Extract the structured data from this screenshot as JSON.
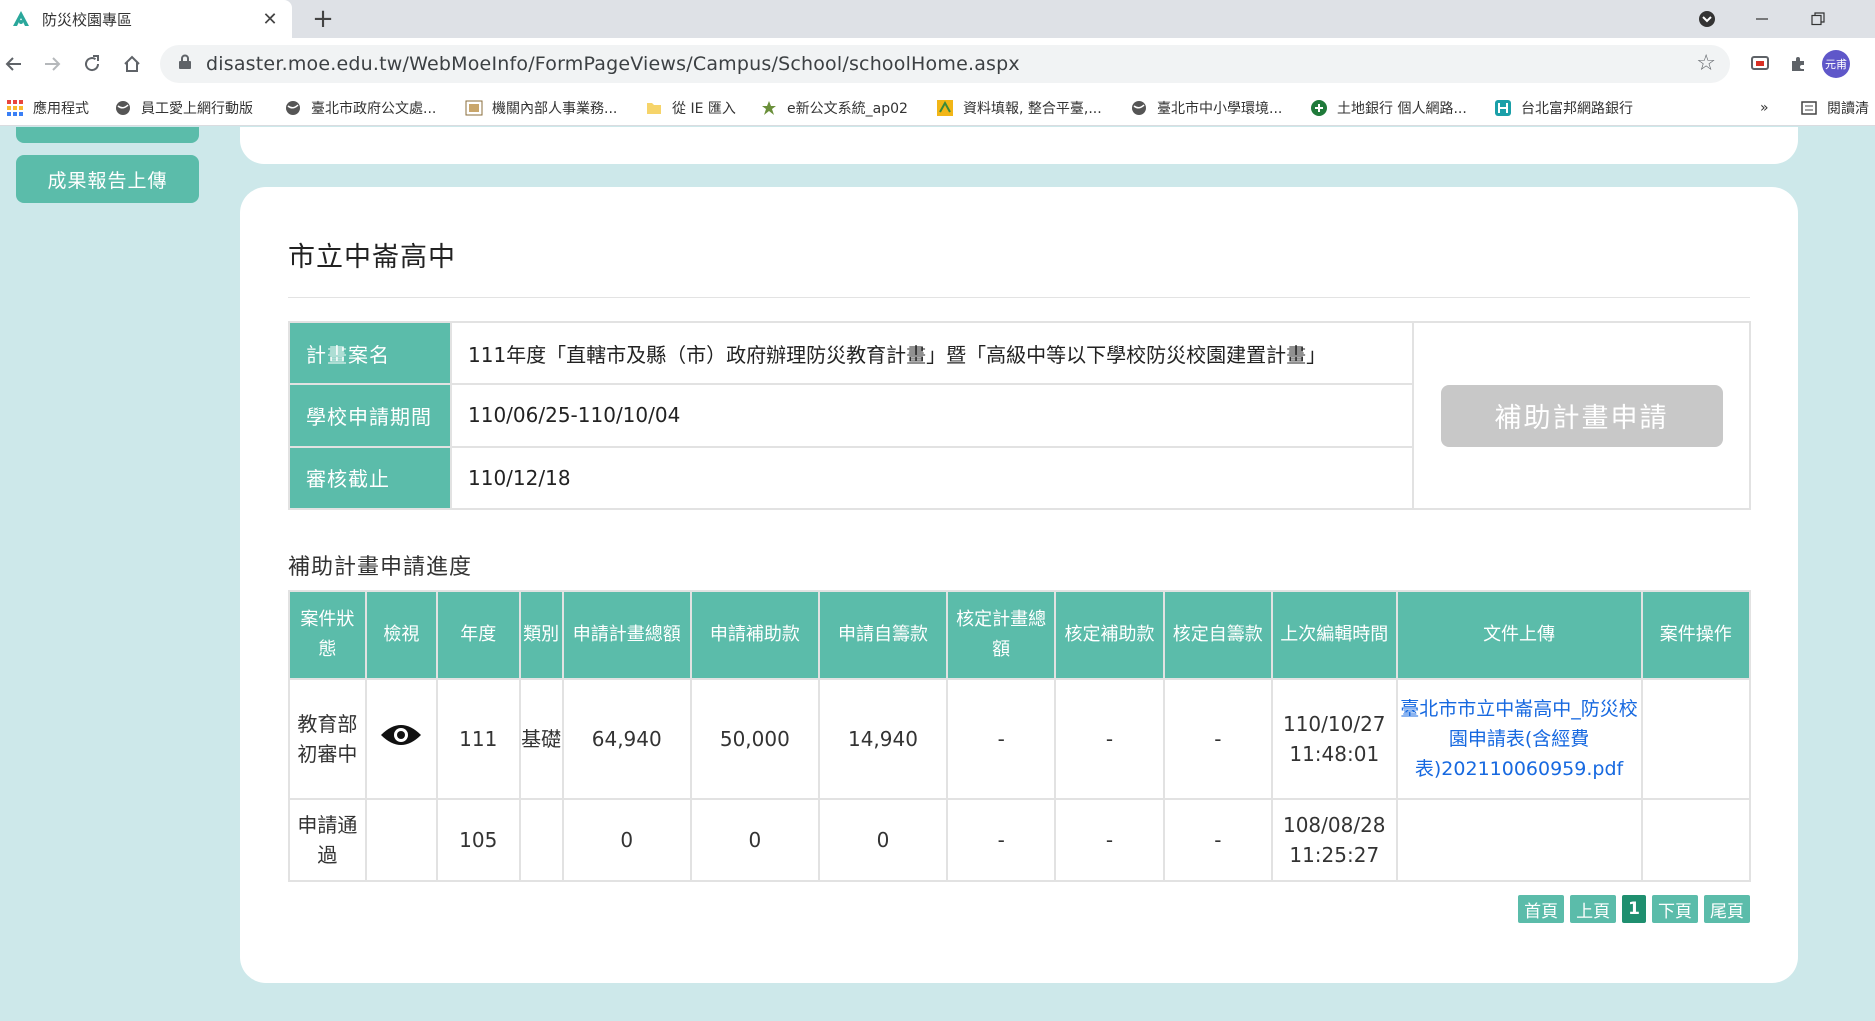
{
  "browser": {
    "tab_title": "防災校園專區",
    "new_tab": "+",
    "close": "✕",
    "url": "disaster.moe.edu.tw/WebMoeInfo/FormPageViews/Campus/School/schoolHome.aspx",
    "profile_label": "元甫",
    "bookmarks": [
      {
        "label": "應用程式",
        "icon": "apps-grid-icon"
      },
      {
        "label": "員工愛上網行動版",
        "icon": "globe-icon"
      },
      {
        "label": "臺北市政府公文處...",
        "icon": "globe-icon"
      },
      {
        "label": "機關內部人事業務...",
        "icon": "site-icon"
      },
      {
        "label": "從 IE 匯入",
        "icon": "folder-icon"
      },
      {
        "label": "e新公文系統_ap02",
        "icon": "site-icon"
      },
      {
        "label": "資料填報, 整合平臺,...",
        "icon": "site-icon"
      },
      {
        "label": "臺北市中小學環境...",
        "icon": "globe-icon"
      },
      {
        "label": "土地銀行 個人網路...",
        "icon": "bank-icon"
      },
      {
        "label": "台北富邦網路銀行",
        "icon": "bank-icon"
      }
    ],
    "bookmarks_overflow": "»",
    "reading_list": "閱讀清"
  },
  "sidebar": {
    "upload_report": "成果報告上傳"
  },
  "school": {
    "name": "市立中崙高中"
  },
  "plan_info": {
    "rows": [
      {
        "label": "計畫案名",
        "value": "111年度「直轄市及縣（市）政府辦理防災教育計畫」暨「高級中等以下學校防災校園建置計畫」"
      },
      {
        "label": "學校申請期間",
        "value": "110/06/25-110/10/04"
      },
      {
        "label": "審核截止",
        "value": "110/12/18"
      }
    ],
    "apply_button": "補助計畫申請"
  },
  "progress": {
    "title": "補助計畫申請進度",
    "headers": [
      "案件狀態",
      "檢視",
      "年度",
      "類別",
      "申請計畫總額",
      "申請補助款",
      "申請自籌款",
      "核定計畫總額",
      "核定補助款",
      "核定自籌款",
      "上次編輯時間",
      "文件上傳",
      "案件操作"
    ],
    "rows": [
      {
        "status": "教育部初審中",
        "view": "eye-icon",
        "year": "111",
        "category": "基礎",
        "apply_total": "64,940",
        "apply_subsidy": "50,000",
        "apply_self": "14,940",
        "approved_total": "-",
        "approved_subsidy": "-",
        "approved_self": "-",
        "last_edit_date": "110/10/27",
        "last_edit_time": "11:48:01",
        "document": "臺北市市立中崙高中_防災校園申請表(含經費表)202110060959.pdf",
        "operation": ""
      },
      {
        "status": "申請通過",
        "view": "",
        "year": "105",
        "category": "",
        "apply_total": "0",
        "apply_subsidy": "0",
        "apply_self": "0",
        "approved_total": "-",
        "approved_subsidy": "-",
        "approved_self": "-",
        "last_edit_date": "108/08/28",
        "last_edit_time": "11:25:27",
        "document": "",
        "operation": ""
      }
    ]
  },
  "pager": {
    "first": "首頁",
    "prev": "上頁",
    "current": "1",
    "next": "下頁",
    "last": "尾頁"
  },
  "colors": {
    "accent": "#5bbcaa",
    "page_bg": "#cde8ea",
    "disabled_button": "#c8c8c8",
    "link": "#1769e0"
  }
}
